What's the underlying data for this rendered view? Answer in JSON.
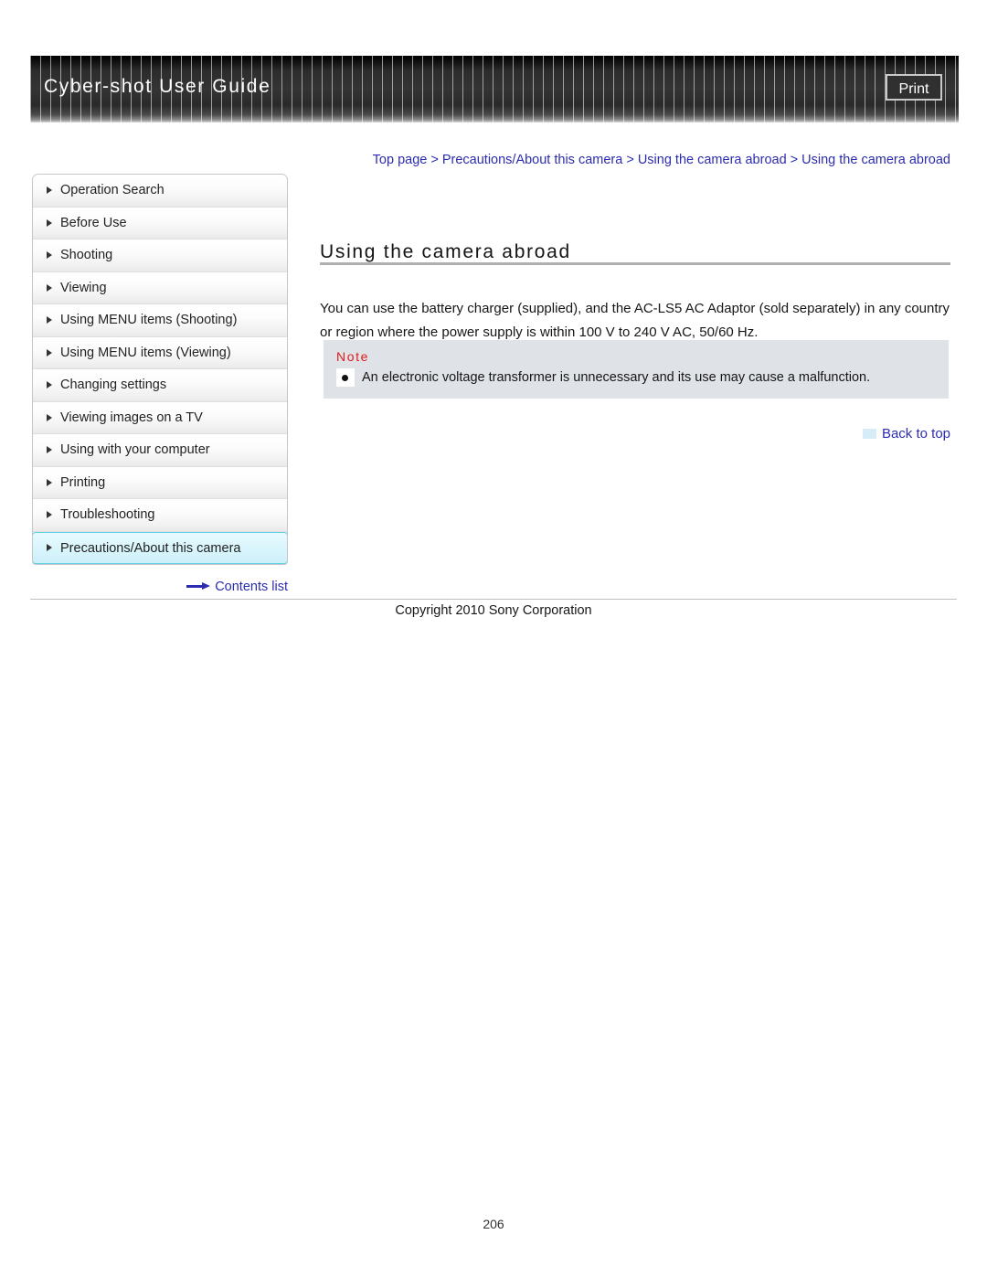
{
  "header": {
    "title": "Cyber-shot User Guide",
    "print_label": "Print"
  },
  "breadcrumb": {
    "text": "Top page > Precautions/About this camera > Using the camera abroad > Using the camera abroad"
  },
  "sidebar": {
    "items": [
      {
        "label": "Operation Search",
        "active": false
      },
      {
        "label": "Before Use",
        "active": false
      },
      {
        "label": "Shooting",
        "active": false
      },
      {
        "label": "Viewing",
        "active": false
      },
      {
        "label": "Using MENU items (Shooting)",
        "active": false
      },
      {
        "label": "Using MENU items (Viewing)",
        "active": false
      },
      {
        "label": "Changing settings",
        "active": false
      },
      {
        "label": "Viewing images on a TV",
        "active": false
      },
      {
        "label": "Using with your computer",
        "active": false
      },
      {
        "label": "Printing",
        "active": false
      },
      {
        "label": "Troubleshooting",
        "active": false
      },
      {
        "label": "Precautions/About this camera",
        "active": true
      }
    ],
    "contents_list_label": "Contents list"
  },
  "main": {
    "title": "Using the camera abroad",
    "body": "You can use the battery charger (supplied), and the AC-LS5 AC Adaptor (sold separately) in any country or region where the power supply is within 100 V to 240 V AC, 50/60 Hz.",
    "note": {
      "label": "Note",
      "items": [
        "An electronic voltage transformer is unnecessary and its use may cause a malfunction."
      ]
    },
    "back_to_top_label": "Back to top"
  },
  "footer": {
    "copyright": "Copyright 2010 Sony Corporation",
    "page_number": "206"
  },
  "colors": {
    "link": "#2c2cb0",
    "note_label": "#e01b1b",
    "active_nav_bg": "#dbf6fc",
    "active_nav_border": "#5fd2e8",
    "note_bg": "#dfe2e6"
  }
}
